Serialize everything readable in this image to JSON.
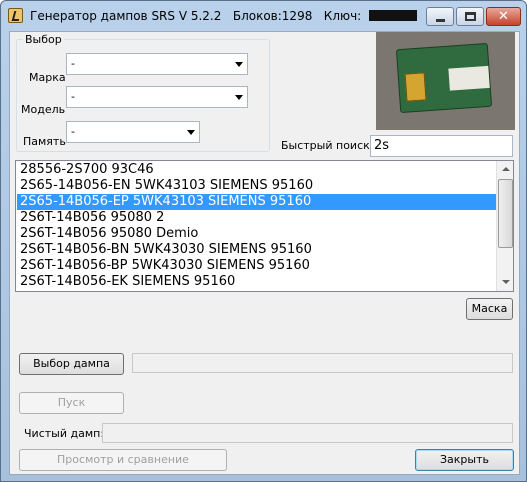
{
  "window": {
    "title": "Генератор дампов SRS V 5.2.2",
    "blocks": "Блоков:1298",
    "key_label": "Ключ:",
    "minimize_glyph": "",
    "close_glyph": "✕"
  },
  "group": {
    "caption": "Выбор",
    "make_label": "Марка",
    "make_value": "-",
    "model_label": "Модель",
    "model_value": "-",
    "memory_label": "Память",
    "memory_value": "-"
  },
  "search": {
    "label": "Быстрый поиск:",
    "value": "2s"
  },
  "list": {
    "selected_index": 2,
    "items": [
      "28556-2S700 93C46",
      "2S65-14B056-EN 5WK43103 SIEMENS 95160",
      "2S65-14B056-EP 5WK43103 SIEMENS 95160",
      "2S6T-14B056 95080 2",
      "2S6T-14B056 95080 Demio",
      "2S6T-14B056-BN 5WK43030 SIEMENS 95160",
      "2S6T-14B056-BP 5WK43030 SIEMENS 95160",
      "2S6T-14B056-EK SIEMENS 95160"
    ]
  },
  "buttons": {
    "mask": "Маска",
    "select_dump": "Выбор дампа",
    "start": "Пуск",
    "view_compare": "Просмотр и сравнение",
    "close": "Закрыть"
  },
  "clean_dump_label": "Чистый дамп:",
  "colors": {
    "selection": "#3399ff",
    "titlebar": "#b9d1ea",
    "client": "#f0f0f0"
  }
}
